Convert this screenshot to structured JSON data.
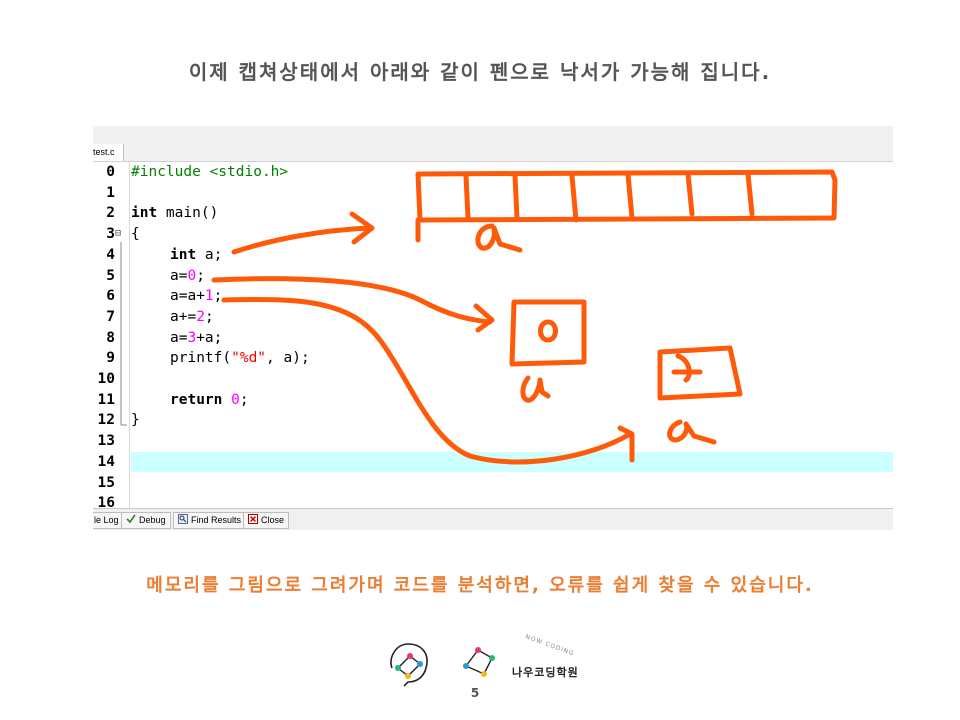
{
  "slide": {
    "title": "이제 캡쳐상태에서 아래와 같이 펜으로 낙서가 가능해 집니다.",
    "caption": "메모리를 그림으로 그려가며 코드를 분석하면, 오류를 쉽게 찾을 수 있습니다.",
    "page_number": "5"
  },
  "editor": {
    "file_tab": "test.c",
    "line_numbers": [
      "0",
      "1",
      "2",
      "3",
      "4",
      "5",
      "6",
      "7",
      "8",
      "9",
      "10",
      "11",
      "12",
      "13",
      "14",
      "15",
      "16"
    ],
    "code": {
      "l0_directive": "#include",
      "l0_header": " <stdio.h>",
      "l2_kw": "int",
      "l2_rest": " main()",
      "l3": "{",
      "l4_kw": "int",
      "l4_rest": " a;",
      "l5_a": "a=",
      "l5_num": "0",
      "l5_end": ";",
      "l6_a": "a=a+",
      "l6_num": "1",
      "l6_end": ";",
      "l7_a": "a+=",
      "l7_num": "2",
      "l7_end": ";",
      "l8_a": "a=",
      "l8_num": "3",
      "l8_end": "+a;",
      "l9_a": "printf(",
      "l9_str": "\"%d\"",
      "l9_end": ", a);",
      "l11_kw": "return",
      "l11_num": " 0",
      "l11_end": ";",
      "l12": "}"
    },
    "highlighted_line": 14,
    "fold_marker": "⊟"
  },
  "bottom_tabs": [
    {
      "label": "le Log",
      "icon": "compile-log-icon"
    },
    {
      "label": "Debug",
      "icon": "debug-check-icon"
    },
    {
      "label": "Find Results",
      "icon": "find-results-icon"
    },
    {
      "label": "Close",
      "icon": "close-icon"
    }
  ],
  "annotations": {
    "box_value_1": "0",
    "box_value_2": "1",
    "var_label": "a"
  },
  "brand": {
    "name": "나우코딩학원",
    "arc_text": "NOW CODING"
  },
  "colors": {
    "pen": "#ff5a0a",
    "caption": "#ed7d31",
    "highlight": "#ccffff",
    "preprocessor": "#008000",
    "number": "#ff00ff",
    "string": "#ff0000"
  }
}
